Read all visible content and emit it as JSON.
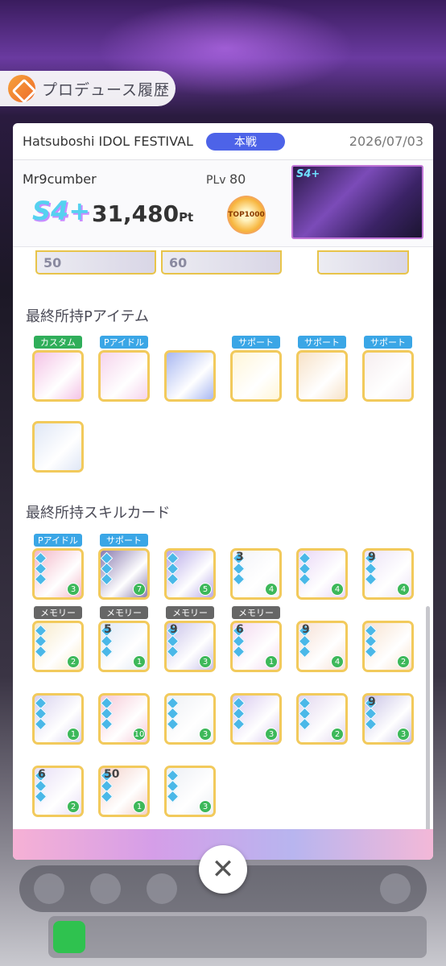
{
  "header": {
    "title": "プロデュース履歴"
  },
  "record": {
    "event_name": "Hatsuboshi IDOL FESTIVAL",
    "badge": "本戦",
    "date": "2026/07/03"
  },
  "player": {
    "name": "Mr9cumber",
    "level_label": "PLv",
    "level": "80",
    "rank": "S4+",
    "score": "31,480",
    "score_unit": "Pt",
    "medal_text": "TOP1000",
    "thumb_rank": "S4+"
  },
  "strip": {
    "left_value": "50",
    "mid_value": "60"
  },
  "items_section": {
    "title": "最終所持Pアイテム",
    "items": [
      {
        "label": "カスタム",
        "label_color": "#2fae5a",
        "tint": "#f4c3e6"
      },
      {
        "label": "Pアイドル",
        "label_color": "#3aa6e6",
        "tint": "#f6d4ec"
      },
      {
        "label": "",
        "label_color": "",
        "tint": "#a9b8f2"
      },
      {
        "label": "サポート",
        "label_color": "#3aa6e6",
        "tint": "#fff6d8"
      },
      {
        "label": "サポート",
        "label_color": "#3aa6e6",
        "tint": "#f7e2c8"
      },
      {
        "label": "サポート",
        "label_color": "#3aa6e6",
        "tint": "#f6eef0"
      },
      {
        "label": "",
        "label_color": "",
        "tint": "#dfe7f6"
      }
    ]
  },
  "cards_section": {
    "title": "最終所持スキルカード",
    "cards": [
      {
        "label": "Pアイドル",
        "num": "",
        "cost": "3",
        "tint": "#f3b7c8"
      },
      {
        "label": "サポート",
        "num": "",
        "cost": "7",
        "tint": "#8a7bb0"
      },
      {
        "label": "",
        "num": "",
        "cost": "5",
        "tint": "#b6a8e8"
      },
      {
        "label": "",
        "num": "3",
        "cost": "4",
        "tint": "#f2f2f7"
      },
      {
        "label": "",
        "num": "",
        "cost": "4",
        "tint": "#e9d6f6"
      },
      {
        "label": "",
        "num": "9",
        "cost": "4",
        "tint": "#ece2f6"
      },
      {
        "label": "メモリー",
        "num": "",
        "cost": "2",
        "tint": "#f7e9c6"
      },
      {
        "label": "メモリー",
        "num": "5",
        "cost": "1",
        "tint": "#dfe7f4"
      },
      {
        "label": "メモリー",
        "num": "9",
        "cost": "3",
        "tint": "#c7c0e9"
      },
      {
        "label": "メモリー",
        "num": "6",
        "cost": "1",
        "tint": "#f2d6ee"
      },
      {
        "label": "",
        "num": "9",
        "cost": "4",
        "tint": "#f6dfd3"
      },
      {
        "label": "",
        "num": "",
        "cost": "2",
        "tint": "#f8e2cf"
      },
      {
        "label": "",
        "num": "",
        "cost": "1",
        "tint": "#d9d2ef"
      },
      {
        "label": "",
        "num": "",
        "cost": "10",
        "tint": "#f6c8d6"
      },
      {
        "label": "",
        "num": "",
        "cost": "3",
        "tint": "#eef0f4"
      },
      {
        "label": "",
        "num": "",
        "cost": "3",
        "tint": "#d8c8ef"
      },
      {
        "label": "",
        "num": "",
        "cost": "2",
        "tint": "#e2d6ee"
      },
      {
        "label": "",
        "num": "9",
        "cost": "3",
        "tint": "#c8c2e6"
      },
      {
        "label": "",
        "num": "6",
        "cost": "2",
        "tint": "#e7def6"
      },
      {
        "label": "",
        "num": "50",
        "cost": "1",
        "tint": "#f3d0c8"
      },
      {
        "label": "",
        "num": "",
        "cost": "3",
        "tint": "#eceff4"
      }
    ]
  },
  "close": {
    "symbol": "✕"
  }
}
